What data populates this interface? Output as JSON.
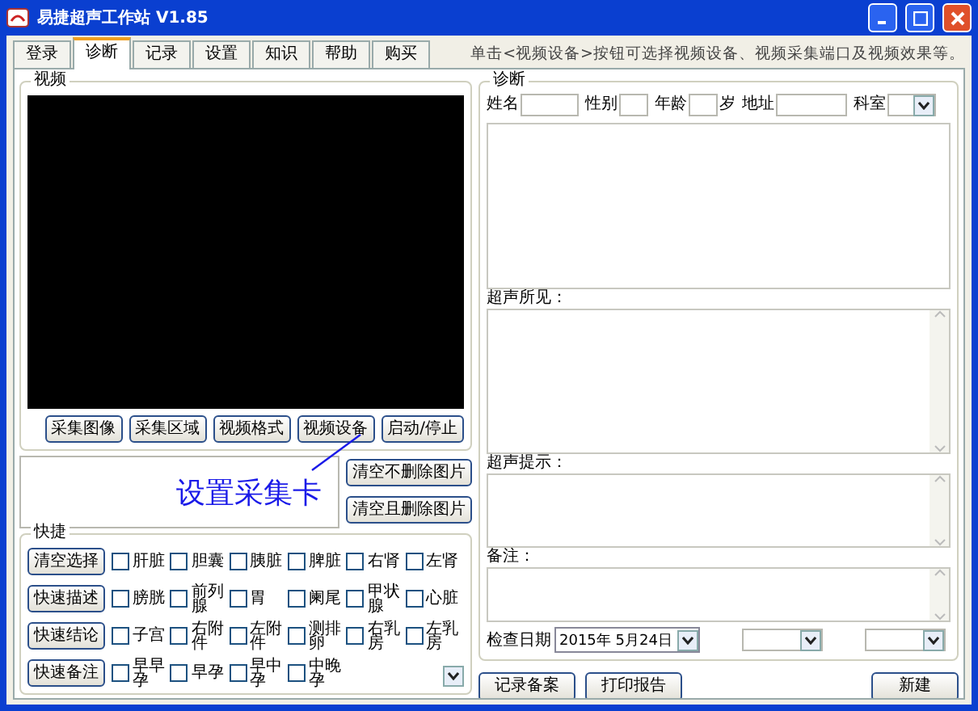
{
  "window": {
    "title": "易捷超声工作站 V1.85"
  },
  "tabs": [
    {
      "label": "登录",
      "selected": false
    },
    {
      "label": "诊断",
      "selected": true
    },
    {
      "label": "记录",
      "selected": false
    },
    {
      "label": "设置",
      "selected": false
    },
    {
      "label": "知识",
      "selected": false
    },
    {
      "label": "帮助",
      "selected": false
    },
    {
      "label": "购买",
      "selected": false
    }
  ],
  "hint": "单击<视频设备>按钮可选择视频设备、视频采集端口及视频效果等。",
  "video": {
    "title": "视频",
    "buttons": [
      "采集图像",
      "采集区域",
      "视频格式",
      "视频设备",
      "启动/停止"
    ]
  },
  "annotation": "设置采集卡",
  "image_buttons": [
    "清空不删除图片",
    "清空且删除图片"
  ],
  "shortcuts": {
    "title": "快捷",
    "buttons": [
      "清空选择",
      "快速描述",
      "快速结论",
      "快速备注"
    ],
    "items": [
      {
        "label": "肝脏",
        "checked": false
      },
      {
        "label": "胆囊",
        "checked": false
      },
      {
        "label": "胰脏",
        "checked": false
      },
      {
        "label": "脾脏",
        "checked": false
      },
      {
        "label": "右肾",
        "checked": false
      },
      {
        "label": "左肾",
        "checked": false
      },
      {
        "label": "膀胱",
        "checked": false
      },
      {
        "label": "前列腺",
        "checked": false
      },
      {
        "label": "胃",
        "checked": false
      },
      {
        "label": "阑尾",
        "checked": false
      },
      {
        "label": "甲状腺",
        "checked": false
      },
      {
        "label": "心脏",
        "checked": false
      },
      {
        "label": "子宫",
        "checked": false
      },
      {
        "label": "右附件",
        "checked": false
      },
      {
        "label": "左附件",
        "checked": false
      },
      {
        "label": "测排卵",
        "checked": false
      },
      {
        "label": "右乳房",
        "checked": false
      },
      {
        "label": "左乳房",
        "checked": false
      },
      {
        "label": "早早孕",
        "checked": false
      },
      {
        "label": "早孕",
        "checked": false
      },
      {
        "label": "早中孕",
        "checked": false
      },
      {
        "label": "中晚孕",
        "checked": false
      }
    ]
  },
  "diagnosis": {
    "title": "诊断",
    "fields": [
      "姓名",
      "性别",
      "年龄",
      "地址",
      "科室"
    ],
    "age_unit": "岁",
    "sections": [
      "超声所见：",
      "超声提示：",
      "备注："
    ],
    "date_label": "检查日期",
    "date_value": "2015年  5月24日"
  },
  "bottom_buttons": [
    "记录备案",
    "打印报告",
    "新建"
  ]
}
